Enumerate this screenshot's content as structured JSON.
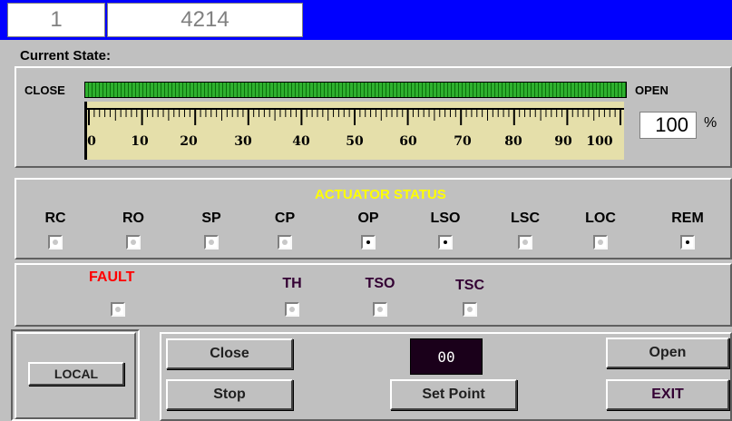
{
  "header": {
    "field1": "1",
    "field2": "4214"
  },
  "current_state": {
    "label": "Current State:",
    "close_label": "CLOSE",
    "open_label": "OPEN",
    "scale_labels": [
      "0",
      "10",
      "20",
      "30",
      "40",
      "50",
      "60",
      "70",
      "80",
      "90",
      "100"
    ],
    "position_percent": 100,
    "value": "100",
    "unit": "%"
  },
  "actuator_status": {
    "title": "ACTUATOR STATUS",
    "items": [
      {
        "label": "RC",
        "on": false
      },
      {
        "label": "RO",
        "on": false
      },
      {
        "label": "SP",
        "on": false
      },
      {
        "label": "CP",
        "on": false
      },
      {
        "label": "OP",
        "on": true
      },
      {
        "label": "LSO",
        "on": true
      },
      {
        "label": "LSC",
        "on": false
      },
      {
        "label": "LOC",
        "on": false
      },
      {
        "label": "REM",
        "on": true
      }
    ]
  },
  "fault": {
    "title": "FAULT",
    "items": [
      {
        "label": "TH",
        "on": false
      },
      {
        "label": "TSO",
        "on": false
      },
      {
        "label": "TSC",
        "on": false
      }
    ]
  },
  "controls": {
    "local": "LOCAL",
    "close": "Close",
    "stop": "Stop",
    "display": "00",
    "set_point": "Set Point",
    "open": "Open",
    "exit": "EXIT"
  },
  "colors": {
    "titlebar": "#0000ff",
    "bar_green": "#2fb02f",
    "scale_bg": "#e5dfaa",
    "status_title": "#ffff00",
    "fault_title": "#ff0000",
    "display_bg": "#1a001a"
  }
}
